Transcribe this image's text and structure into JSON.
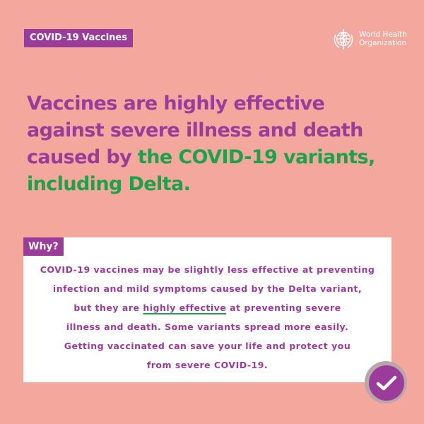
{
  "tag": {
    "label": "COVID-19 Vaccines"
  },
  "organization": {
    "line1": "World Health",
    "line2": "Organization"
  },
  "headline": {
    "line1": "Vaccines are highly effective",
    "line2": "against severe illness and death",
    "line3_purple": "caused by ",
    "line3_green": "the COVID-19 variants,",
    "line4_green": "including Delta."
  },
  "why": {
    "label": "Why?",
    "line1": "COVID-19 vaccines may be slightly less effective at preventing",
    "line2": "infection and mild symptoms caused by the Delta variant,",
    "line3_before": "but they are ",
    "line3_emphasis": "highly effective",
    "line3_after": " at preventing severe",
    "line4": "illness and death. Some variants spread more easily.",
    "line5": "Getting vaccinated can save your life and protect you",
    "line6": "from severe COVID-19."
  },
  "colors": {
    "background": "#f4a79d",
    "purple": "#9b3b9a",
    "green": "#1aa34a",
    "white": "#ffffff"
  },
  "icons": {
    "logo": "who-emblem-icon",
    "badge": "checkmark-icon"
  }
}
